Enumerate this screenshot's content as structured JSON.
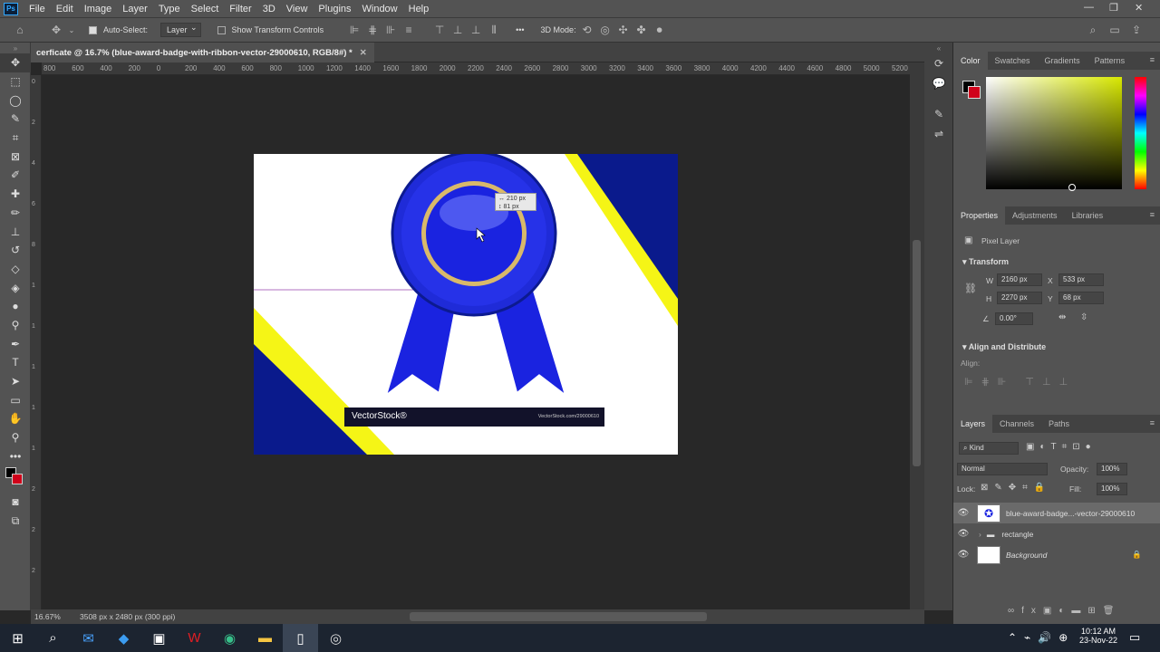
{
  "app": {
    "logo": "Ps"
  },
  "menu": [
    "File",
    "Edit",
    "Image",
    "Layer",
    "Type",
    "Select",
    "Filter",
    "3D",
    "View",
    "Plugins",
    "Window",
    "Help"
  ],
  "window_controls": {
    "minimize": "—",
    "restore": "❐",
    "close": "✕"
  },
  "options_bar": {
    "auto_select_label": "Auto-Select:",
    "auto_select_target": "Layer",
    "show_transform_label": "Show Transform Controls",
    "mode_3d_label": "3D Mode:",
    "more": "•••"
  },
  "document": {
    "tab_title": "cerficate @ 16.7% (blue-award-badge-with-ribbon-vector-29000610, RGB/8#) *",
    "close": "✕",
    "ruler_h": [
      "800",
      "600",
      "400",
      "200",
      "0",
      "200",
      "400",
      "600",
      "800",
      "1000",
      "1200",
      "1400",
      "1600",
      "1800",
      "2000",
      "2200",
      "2400",
      "2600",
      "2800",
      "3000",
      "3200",
      "3400",
      "3600",
      "3800",
      "4000",
      "4200",
      "4400",
      "4600",
      "4800",
      "5000",
      "5200"
    ],
    "ruler_v": [
      "0",
      "2",
      "4",
      "6",
      "8",
      "1",
      "1",
      "1",
      "1",
      "1",
      "2",
      "2",
      "2"
    ],
    "tooltip": {
      "w": "210 px",
      "h": "81 px"
    },
    "watermark_left": "VectorStock®",
    "watermark_right": "VectorStock.com/29000610",
    "colors": {
      "navy": "#0a1a8c",
      "yellow": "#f5f516",
      "blue": "#1a23e0",
      "gold": "#d9b96a"
    }
  },
  "status": {
    "zoom": "16.67%",
    "info": "3508 px x 2480 px (300 ppi)"
  },
  "color_panel": {
    "tabs": [
      "Color",
      "Swatches",
      "Gradients",
      "Patterns"
    ],
    "fg": "#000000",
    "bg": "#d0021b",
    "hue": "#d8e800"
  },
  "properties": {
    "tabs": [
      "Properties",
      "Adjustments",
      "Libraries"
    ],
    "layer_type": "Pixel Layer",
    "transform_title": "Transform",
    "w_label": "W",
    "w": "2160 px",
    "x_label": "X",
    "x": "533 px",
    "h_label": "H",
    "h": "2270 px",
    "y_label": "Y",
    "y": "68 px",
    "angle": "0.00°",
    "align_title": "Align and Distribute",
    "align_label": "Align:"
  },
  "layers": {
    "tabs": [
      "Layers",
      "Channels",
      "Paths"
    ],
    "filter_kind": "Kind",
    "blend_mode": "Normal",
    "opacity_label": "Opacity:",
    "opacity": "100%",
    "lock_label": "Lock:",
    "fill_label": "Fill:",
    "fill": "100%",
    "items": [
      {
        "name": "blue-award-badge...-vector-29000610"
      },
      {
        "name": "rectangle"
      },
      {
        "name": "Background"
      }
    ]
  },
  "taskbar": {
    "time": "10:12 AM",
    "date": "23-Nov-22"
  }
}
